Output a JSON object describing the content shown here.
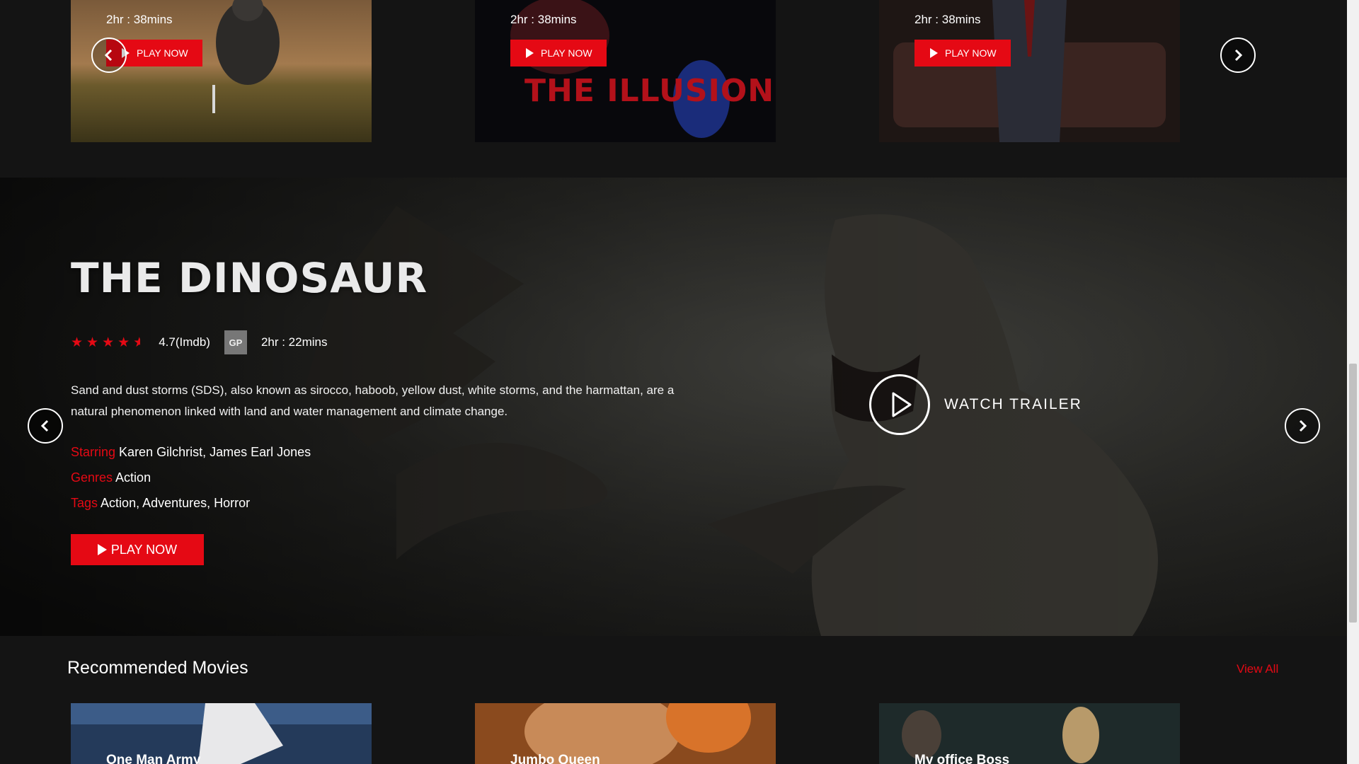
{
  "top_row": {
    "cards": [
      {
        "duration": "2hr : 38mins",
        "play_label": "PLAY NOW"
      },
      {
        "duration": "2hr : 38mins",
        "play_label": "PLAY NOW",
        "art_text": "THE ILLUSION"
      },
      {
        "duration": "2hr : 38mins",
        "play_label": "PLAY NOW"
      }
    ]
  },
  "hero": {
    "title": "THE DINOSAUR",
    "rating_stars": 4.5,
    "rating_value": "4.7(Imdb)",
    "certificate": "GP",
    "duration": "2hr : 22mins",
    "description": "Sand and dust storms (SDS), also known as sirocco, haboob, yellow dust, white storms, and the harmattan, are a natural phenomenon linked with land and water management and climate change.",
    "starring_key": "Starring",
    "starring_value": "Karen Gilchrist, James Earl Jones",
    "genres_key": "Genres",
    "genres_value": "Action",
    "tags_key": "Tags",
    "tags_value": "Action, Adventures, Horror",
    "play_label": "PLAY NOW",
    "trailer_label": "WATCH TRAILER"
  },
  "recommended": {
    "title": "Recommended Movies",
    "view_all": "View All",
    "cards": [
      {
        "name": "One Man Army"
      },
      {
        "name": "Jumbo Queen"
      },
      {
        "name": "My office Boss"
      }
    ]
  },
  "colors": {
    "accent": "#e50914",
    "background": "#141414"
  },
  "icons": [
    "play-icon",
    "chevron-left-icon",
    "chevron-right-icon",
    "star-icon",
    "half-star-icon",
    "play-circle-icon"
  ]
}
